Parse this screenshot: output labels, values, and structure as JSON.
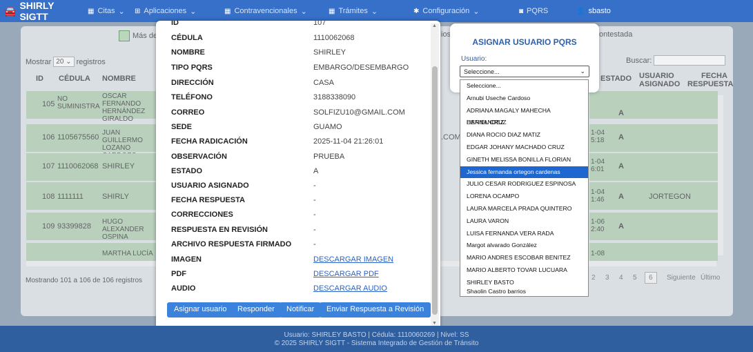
{
  "nav": {
    "brand": "SHIRLY SIGTT",
    "items": [
      "Citas",
      "Aplicaciones",
      "Contravencionales",
      "Trámites",
      "Configuración",
      "PQRS",
      "sbasto"
    ]
  },
  "legend": {
    "label": "Más de"
  },
  "page_right_fragments": {
    "top_a": "ios",
    "top_b": "ontestada"
  },
  "table": {
    "mostrar": "Mostrar",
    "mostrar_value": "20",
    "registros": "registros",
    "buscar": "Buscar:",
    "headers": {
      "id": "ID",
      "cedula": "CÉDULA",
      "nombre": "NOMBRE",
      "estado": "ESTADO",
      "usuario_asignado_1": "USUARIO",
      "usuario_asignado_2": "ASIGNADO",
      "fecha_respuesta_1": "FECHA",
      "fecha_respuesta_2": "RESPUESTA"
    },
    "rows": [
      {
        "id": "105",
        "cedula": "NO SUMINISTRA",
        "nombre": "OSCAR FERNANDO HERNÁNDEZ GIRALDO",
        "fecha": "",
        "estado": "A",
        "usuario": ""
      },
      {
        "id": "106",
        "cedula": "1105675560",
        "nombre": "JUAN GUILLERMO LOZANO CARDOZO",
        "email_frag": ".COM",
        "fecha": "1-04 5:18",
        "estado": "A",
        "usuario": ""
      },
      {
        "id": "107",
        "cedula": "1110062068",
        "nombre": "SHIRLEY",
        "fecha": "1-04 6:01",
        "estado": "A",
        "usuario": ""
      },
      {
        "id": "108",
        "cedula": "1111111",
        "nombre": "SHIRLY",
        "fecha": "1-04 1:46",
        "estado": "A",
        "usuario": "JORTEGON"
      },
      {
        "id": "109",
        "cedula": "93399828",
        "nombre": "HUGO ALEXANDER OSPINA",
        "fecha": "1-06 2:40",
        "estado": "A",
        "usuario": ""
      },
      {
        "id": "",
        "cedula": "",
        "nombre": "MARTHA LUCÍA",
        "fecha": "1-08",
        "estado": "",
        "usuario": ""
      }
    ],
    "mostrando": "Mostrando 101 a 106 de 106 registros",
    "pagination": [
      "2",
      "3",
      "4",
      "5",
      "6",
      "Siguiente",
      "Último"
    ]
  },
  "modal": {
    "top_label": "ID",
    "top_value": "107",
    "fields": [
      {
        "label": "CÉDULA",
        "value": "1110062068"
      },
      {
        "label": "NOMBRE",
        "value": "SHIRLEY"
      },
      {
        "label": "TIPO PQRS",
        "value": "EMBARGO/DESEMBARGO"
      },
      {
        "label": "DIRECCIÓN",
        "value": "CASA"
      },
      {
        "label": "TELÉFONO",
        "value": "3188338090"
      },
      {
        "label": "CORREO",
        "value": "SOLFIZU10@GMAIL.COM"
      },
      {
        "label": "SEDE",
        "value": "GUAMO"
      },
      {
        "label": "FECHA RADICACIÓN",
        "value": "2025-11-04 21:26:01"
      },
      {
        "label": "OBSERVACIÓN",
        "value": "PRUEBA"
      },
      {
        "label": "ESTADO",
        "value": "A"
      },
      {
        "label": "USUARIO ASIGNADO",
        "value": "-"
      },
      {
        "label": "FECHA RESPUESTA",
        "value": "-"
      },
      {
        "label": "CORRECCIONES",
        "value": "-"
      },
      {
        "label": "RESPUESTA EN REVISIÓN",
        "value": "-"
      },
      {
        "label": "ARCHIVO RESPUESTA FIRMADO",
        "value": "-"
      },
      {
        "label": "IMAGEN",
        "value": "DESCARGAR IMAGEN"
      },
      {
        "label": "PDF",
        "value": "DESCARGAR PDF"
      },
      {
        "label": "AUDIO",
        "value": "DESCARGAR AUDIO"
      }
    ],
    "buttons": [
      "Asignar usuario",
      "Responder",
      "Notificar",
      "Enviar Respuesta a Revisión"
    ]
  },
  "assign": {
    "title": "ASIGNAR USUARIO PQRS",
    "label": "Usuario:",
    "selected": "Seleccione...",
    "options": [
      "Seleccione...",
      "Arnubi Useche Cardoso",
      "ADRIANA MAGALY MAHECHA HERNANDEZ",
      "DANIEL CRUZ",
      "DIANA ROCIO DIAZ MATIZ",
      "EDGAR JOHANY MACHADO CRUZ",
      "GINETH MELISSA BONILLA FLORIAN",
      "Jessica fernanda ortegon cardenas",
      "JULIO CESAR RODRIGUEZ ESPINOSA",
      "LORENA OCAMPO",
      "LAURA MARCELA PRADA QUINTERO",
      "LAURA VARON",
      "LUISA FERNANDA VERA RADA",
      "Margot alvarado González",
      "MARIO ANDRES ESCOBAR BENITEZ",
      "MARIO ALBERTO TOVAR LUCUARA",
      "SHIRLEY BASTO",
      "Shaolin Castro barrios"
    ],
    "highlighted_index": 7
  },
  "footer": {
    "line1": "Usuario: SHIRLEY BASTO | Cédula: 1110060269 | Nivel: SS",
    "line2": "© 2025 SHIRLY SIGTT - Sistema Integrado de Gestión de Tránsito"
  },
  "colors": {
    "nav": "#3670c9",
    "footer": "#2f5f9f",
    "accent": "#3b82dc",
    "highlight": "#1f67d0",
    "row_green": "#a8cba8"
  }
}
